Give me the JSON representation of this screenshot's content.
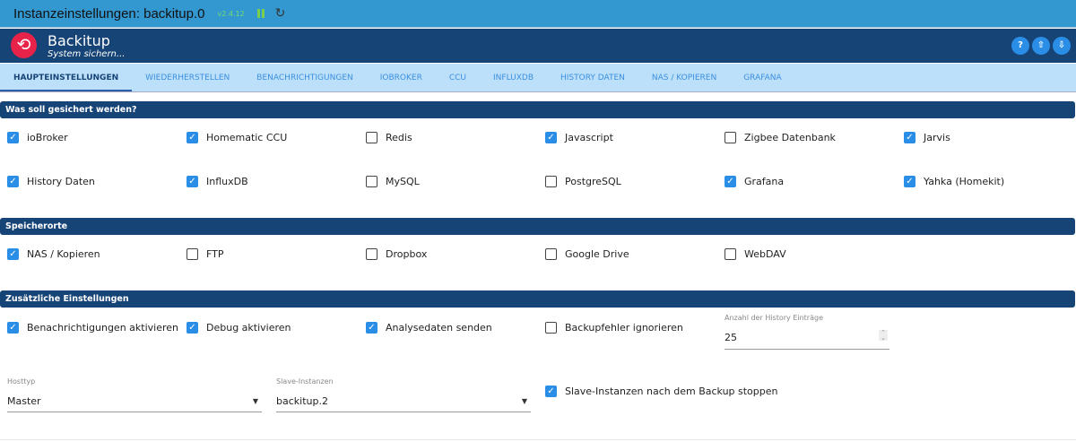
{
  "topbar": {
    "title": "Instanzeinstellungen: backitup.0",
    "version": "v2.4.12",
    "reload_icon": "↻"
  },
  "header": {
    "app_name": "Backitup",
    "subtitle": "System sichern...",
    "buttons": [
      {
        "icon": "help-icon",
        "glyph": "?"
      },
      {
        "icon": "upload-icon",
        "glyph": "⇧"
      },
      {
        "icon": "download-icon",
        "glyph": "⇩"
      }
    ]
  },
  "tabs": [
    "HAUPTEINSTELLUNGEN",
    "WIEDERHERSTELLEN",
    "BENACHRICHTIGUNGEN",
    "IOBROKER",
    "CCU",
    "INFLUXDB",
    "HISTORY DATEN",
    "NAS / KOPIEREN",
    "GRAFANA"
  ],
  "sections": {
    "what": "Was soll gesichert werden?",
    "storage": "Speicherorte",
    "extra": "Zusätzliche Einstellungen"
  },
  "what_items": [
    {
      "label": "ioBroker",
      "checked": true
    },
    {
      "label": "Homematic CCU",
      "checked": true
    },
    {
      "label": "Redis",
      "checked": false
    },
    {
      "label": "Javascript",
      "checked": true
    },
    {
      "label": "Zigbee Datenbank",
      "checked": false
    },
    {
      "label": "Jarvis",
      "checked": true
    },
    {
      "label": "History Daten",
      "checked": true
    },
    {
      "label": "InfluxDB",
      "checked": true
    },
    {
      "label": "MySQL",
      "checked": false
    },
    {
      "label": "PostgreSQL",
      "checked": false
    },
    {
      "label": "Grafana",
      "checked": true
    },
    {
      "label": "Yahka (Homekit)",
      "checked": true
    }
  ],
  "storage_items": [
    {
      "label": "NAS / Kopieren",
      "checked": true
    },
    {
      "label": "FTP",
      "checked": false
    },
    {
      "label": "Dropbox",
      "checked": false
    },
    {
      "label": "Google Drive",
      "checked": false
    },
    {
      "label": "WebDAV",
      "checked": false
    }
  ],
  "extra_items": [
    {
      "label": "Benachrichtigungen aktivieren",
      "checked": true
    },
    {
      "label": "Debug aktivieren",
      "checked": true
    },
    {
      "label": "Analysedaten senden",
      "checked": true
    },
    {
      "label": "Backupfehler ignorieren",
      "checked": false
    }
  ],
  "history_count": {
    "label": "Anzahl der History Einträge",
    "value": "25"
  },
  "hosttyp": {
    "label": "Hosttyp",
    "value": "Master"
  },
  "slave": {
    "label": "Slave-Instanzen",
    "value": "backitup.2"
  },
  "slave_stop": {
    "label": "Slave-Instanzen nach dem Backup stoppen",
    "checked": true
  }
}
